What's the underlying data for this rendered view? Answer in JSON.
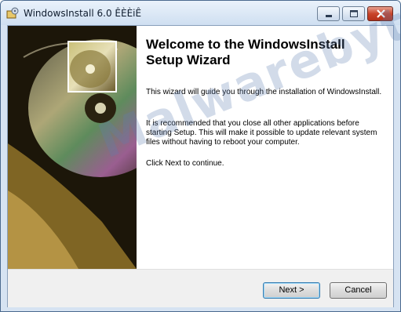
{
  "window": {
    "title": "WindowsInstall 6.0 ÊÈÈiÊ"
  },
  "main": {
    "heading": "Welcome to the WindowsInstall Setup Wizard",
    "paragraph1": "This wizard will guide you through the installation of WindowsInstall.",
    "paragraph2": "It is recommended that you close all other applications before starting Setup. This will make it possible to update relevant system files without having to reboot your computer.",
    "paragraph3": "Click Next to continue."
  },
  "buttons": {
    "next": "Next >",
    "cancel": "Cancel"
  },
  "watermark": {
    "text": "Malwarebytes"
  },
  "icons": [
    "installer-app-icon",
    "minimize-icon",
    "maximize-icon",
    "close-icon"
  ],
  "colors": {
    "titlebar": "#d6e3f2",
    "close_button": "#c9442a",
    "watermark": "#5f7daf"
  }
}
